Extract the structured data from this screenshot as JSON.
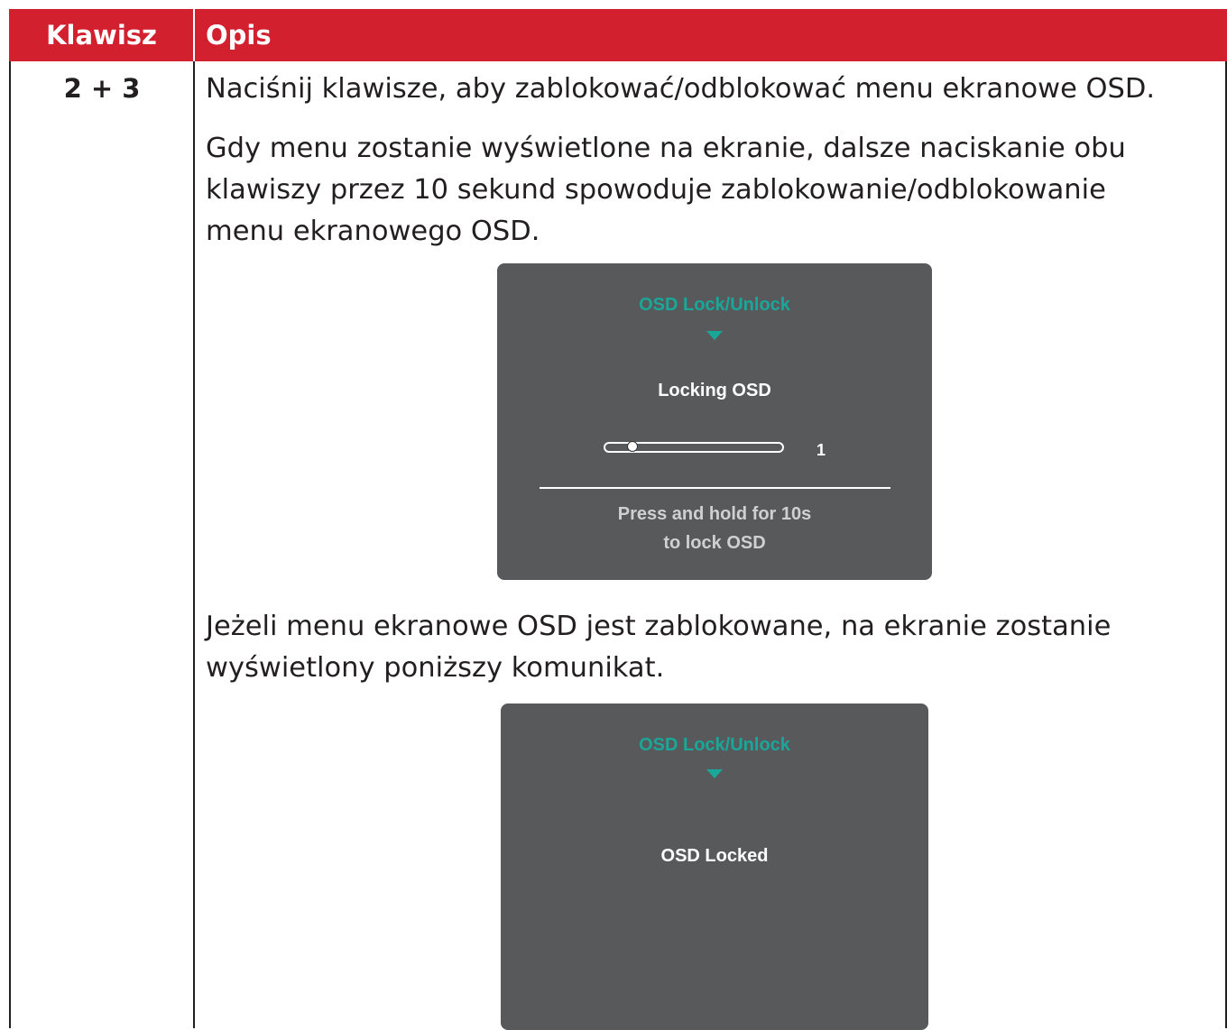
{
  "header": {
    "key_col": "Klawisz",
    "desc_col": "Opis"
  },
  "row": {
    "key": "2 + 3",
    "paragraphs": [
      "Naciśnij klawisze, aby zablokować/odblokować menu ekranowe OSD.",
      "Gdy menu zostanie wyświetlone na ekranie, dalsze naciskanie obu\nklawiszy przez 10 sekund spowoduje zablokowanie/odblokowanie\nmenu ekranowego OSD.",
      "Jeżeli menu ekranowe OSD jest zablokowane, na ekranie zostanie\nwyświetlony poniższy komunikat."
    ]
  },
  "osd_locking": {
    "title": "OSD Lock/Unlock",
    "status": "Locking OSD",
    "progress_fraction": 0.1,
    "count": "1",
    "hint": "Press and hold for 10s\nto lock OSD"
  },
  "osd_locked": {
    "title": "OSD Lock/Unlock",
    "status": "OSD Locked"
  },
  "colors": {
    "header_bg": "#d2202f",
    "osd_bg": "#58595b",
    "osd_accent": "#19a79a"
  }
}
